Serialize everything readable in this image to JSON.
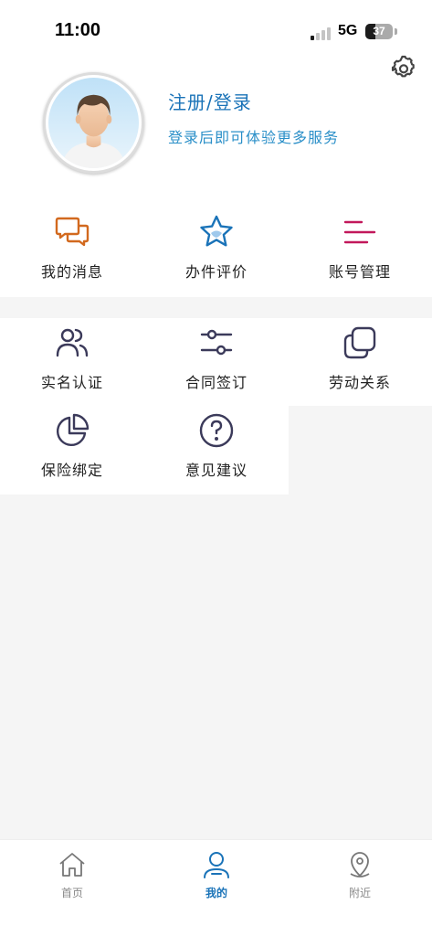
{
  "status_bar": {
    "time": "11:00",
    "network": "5G",
    "battery": "37",
    "battery_level": 0.37
  },
  "profile": {
    "title": "注册/登录",
    "subtitle": "登录后即可体验更多服务"
  },
  "menu": {
    "row1": [
      {
        "label": "我的消息",
        "icon": "chat-bubbles-icon",
        "color": "#d2691e"
      },
      {
        "label": "办件评价",
        "icon": "star-icon",
        "color": "#1a73b8"
      },
      {
        "label": "账号管理",
        "icon": "menu-lines-icon",
        "color": "#c2185b"
      }
    ],
    "row2": [
      {
        "label": "实名认证",
        "icon": "users-icon",
        "color": "#3b3a5a"
      },
      {
        "label": "合同签订",
        "icon": "sliders-icon",
        "color": "#3b3a5a"
      },
      {
        "label": "劳动关系",
        "icon": "copy-icon",
        "color": "#3b3a5a"
      }
    ],
    "row3": [
      {
        "label": "保险绑定",
        "icon": "pie-chart-icon",
        "color": "#3b3a5a"
      },
      {
        "label": "意见建议",
        "icon": "help-circle-icon",
        "color": "#3b3a5a"
      }
    ]
  },
  "tabbar": [
    {
      "label": "首页",
      "icon": "home-icon",
      "active": false
    },
    {
      "label": "我的",
      "icon": "user-icon",
      "active": true
    },
    {
      "label": "附近",
      "icon": "location-pin-icon",
      "active": false
    }
  ]
}
